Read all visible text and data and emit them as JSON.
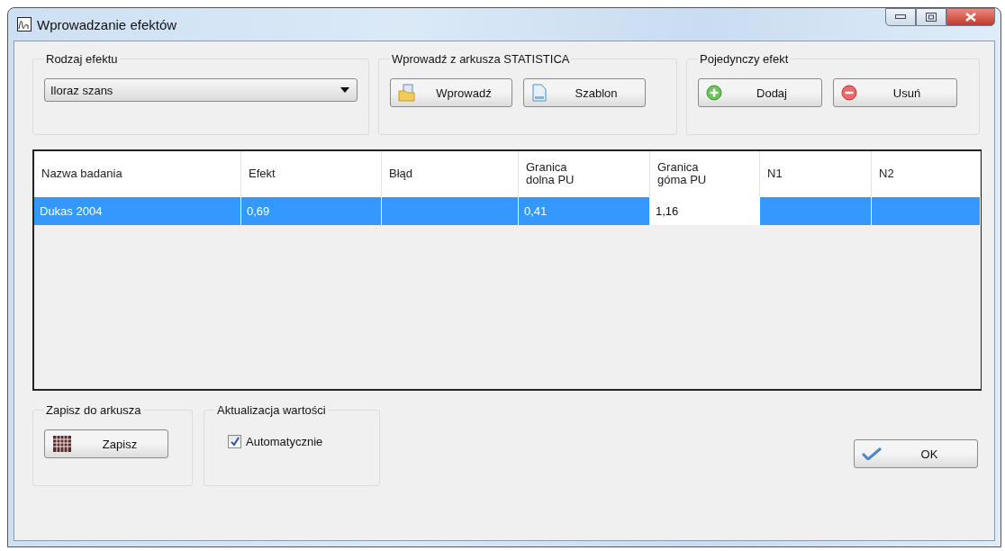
{
  "window": {
    "title": "Wprowadzanie efektów"
  },
  "effect_type": {
    "legend": "Rodzaj efektu",
    "value": "Iloraz szans"
  },
  "import_group": {
    "legend": "Wprowadź z arkusza STATISTICA",
    "buttons": [
      {
        "label": "Wprowadź",
        "kind": "folder"
      },
      {
        "label": "Szablon",
        "kind": "document"
      }
    ]
  },
  "single_group": {
    "legend": "Pojedynczy efekt",
    "buttons": [
      {
        "label": "Dodaj",
        "kind": "plus"
      },
      {
        "label": "Usuń",
        "kind": "minus"
      }
    ]
  },
  "table": {
    "columns": [
      "Nazwa badania",
      "Efekt",
      "Błąd",
      "Granica\ndolna PU",
      "Granica\ngóma PU",
      "N1",
      "N2"
    ],
    "rows": [
      {
        "selected": true,
        "cells": [
          {
            "text": "Dukas 2004",
            "editing": false
          },
          {
            "text": "0,69",
            "editing": false
          },
          {
            "editing": false
          },
          {
            "text": "0,41",
            "editing": false
          },
          {
            "text": "1,16",
            "editing": true
          },
          {
            "editing": false
          },
          {
            "editing": false
          }
        ]
      }
    ]
  },
  "save_group": {
    "legend": "Zapisz do arkusza",
    "button": "Zapisz"
  },
  "update_group": {
    "legend": "Aktualizacja wartości",
    "checkbox": {
      "label": "Automatycznie",
      "checked": true
    }
  },
  "ok_button": "OK"
}
